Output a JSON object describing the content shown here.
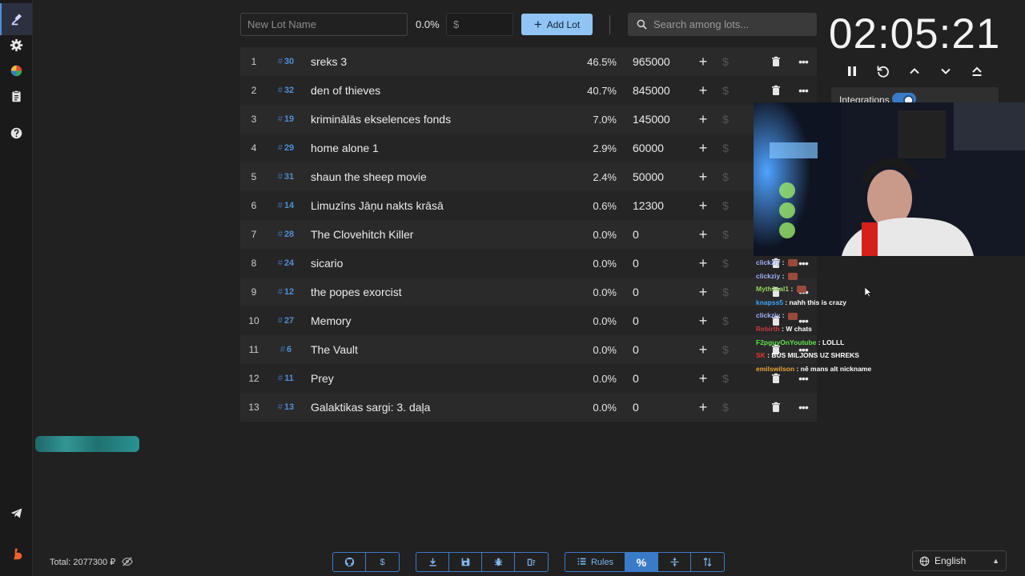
{
  "sidebar": {
    "items": [
      {
        "name": "auction-icon"
      },
      {
        "name": "gear-icon"
      },
      {
        "name": "wheel-icon"
      },
      {
        "name": "clipboard-icon"
      },
      {
        "name": "help-icon"
      },
      {
        "name": "telegram-icon"
      },
      {
        "name": "boosty-icon"
      }
    ]
  },
  "toolbar": {
    "lot_name_placeholder": "New Lot Name",
    "percent": "0.0%",
    "money_placeholder": "$",
    "add_lot_label": "Add Lot",
    "search_placeholder": "Search among lots..."
  },
  "lots": [
    {
      "index": "1",
      "id": "30",
      "name": "sreks 3",
      "percent": "46.5%",
      "amount": "965000"
    },
    {
      "index": "2",
      "id": "32",
      "name": "den of thieves",
      "percent": "40.7%",
      "amount": "845000"
    },
    {
      "index": "3",
      "id": "19",
      "name": "kriminālās ekselences fonds",
      "percent": "7.0%",
      "amount": "145000"
    },
    {
      "index": "4",
      "id": "29",
      "name": "home alone 1",
      "percent": "2.9%",
      "amount": "60000"
    },
    {
      "index": "5",
      "id": "31",
      "name": "shaun the sheep movie",
      "percent": "2.4%",
      "amount": "50000"
    },
    {
      "index": "6",
      "id": "14",
      "name": "Limuzīns Jāņu nakts krāsā",
      "percent": "0.6%",
      "amount": "12300"
    },
    {
      "index": "7",
      "id": "28",
      "name": "The Clovehitch Killer",
      "percent": "0.0%",
      "amount": "0"
    },
    {
      "index": "8",
      "id": "24",
      "name": "sicario",
      "percent": "0.0%",
      "amount": "0"
    },
    {
      "index": "9",
      "id": "12",
      "name": "the popes exorcist",
      "percent": "0.0%",
      "amount": "0"
    },
    {
      "index": "10",
      "id": "27",
      "name": "Memory",
      "percent": "0.0%",
      "amount": "0"
    },
    {
      "index": "11",
      "id": "6",
      "name": "The Vault",
      "percent": "0.0%",
      "amount": "0"
    },
    {
      "index": "12",
      "id": "11",
      "name": "Prey",
      "percent": "0.0%",
      "amount": "0"
    },
    {
      "index": "13",
      "id": "13",
      "name": "Galaktikas sargi: 3. daļa",
      "percent": "0.0%",
      "amount": "0"
    }
  ],
  "timer": {
    "display": "02:05:21"
  },
  "integrations": {
    "label": "Integrations",
    "enabled": true
  },
  "chat": [
    {
      "user": "clickziy",
      "text": "",
      "emote": true
    },
    {
      "user": "clickziy",
      "text": "",
      "emote": true
    },
    {
      "user": "Myth1cal1",
      "text": "",
      "emote": true
    },
    {
      "user": "knapss5",
      "text": "nahh this is crazy",
      "emote": false
    },
    {
      "user": "clickziy",
      "text": "",
      "emote": true
    },
    {
      "user": "Rebirth",
      "text": "W chats",
      "emote": false
    },
    {
      "user": "F2pguyOnYoutube",
      "text": "LOLLL",
      "emote": false
    },
    {
      "user": "SK",
      "text": "BŪS MILJONS UZ SHREKS",
      "emote": false
    },
    {
      "user": "emilswilson",
      "text": "nē mans alt nickname",
      "emote": false
    }
  ],
  "footer": {
    "total": "Total: 2077300 ₽",
    "rules_label": "Rules",
    "language": "English"
  },
  "colors": {
    "accent": "#3a7bc8",
    "add_button": "#90c4f5",
    "lot_id": "#4d8fd6"
  }
}
